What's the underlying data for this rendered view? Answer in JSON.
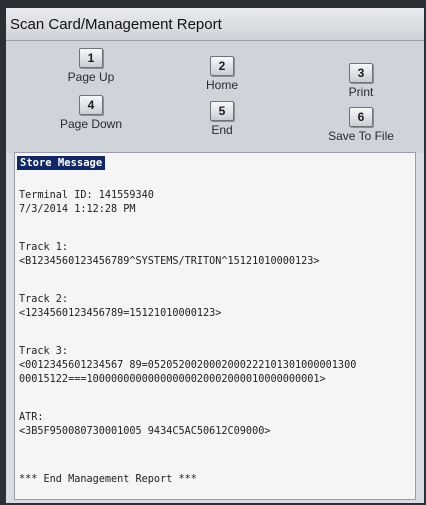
{
  "window": {
    "title": "Scan Card/Management Report"
  },
  "keys": [
    {
      "number": "1",
      "label": "Page Up"
    },
    {
      "number": "2",
      "label": "Home"
    },
    {
      "number": "3",
      "label": "Print"
    },
    {
      "number": "4",
      "label": "Page Down"
    },
    {
      "number": "5",
      "label": "End"
    },
    {
      "number": "6",
      "label": "Save To File"
    }
  ],
  "report": {
    "header": "Store Message",
    "terminal_id": "Terminal ID: 141559340",
    "datetime": "7/3/2014 1:12:28 PM",
    "track1_label": "Track 1:",
    "track1_value": "<B1234560123456789^SYSTEMS/TRITON^15121010000123>",
    "track2_label": "Track 2:",
    "track2_value": "<1234560123456789=15121010000123>",
    "track3_label": "Track 3:",
    "track3_value_line1": "<0012345601234567 89=0520520020002000222101301000001300",
    "track3_value_line2": "00015122===10000000000000000020002000010000000001>",
    "atr_label": "ATR:",
    "atr_value": "<3B5F950080730001005 9434C5AC50612C09000>",
    "footer": "*** End Management Report ***"
  }
}
